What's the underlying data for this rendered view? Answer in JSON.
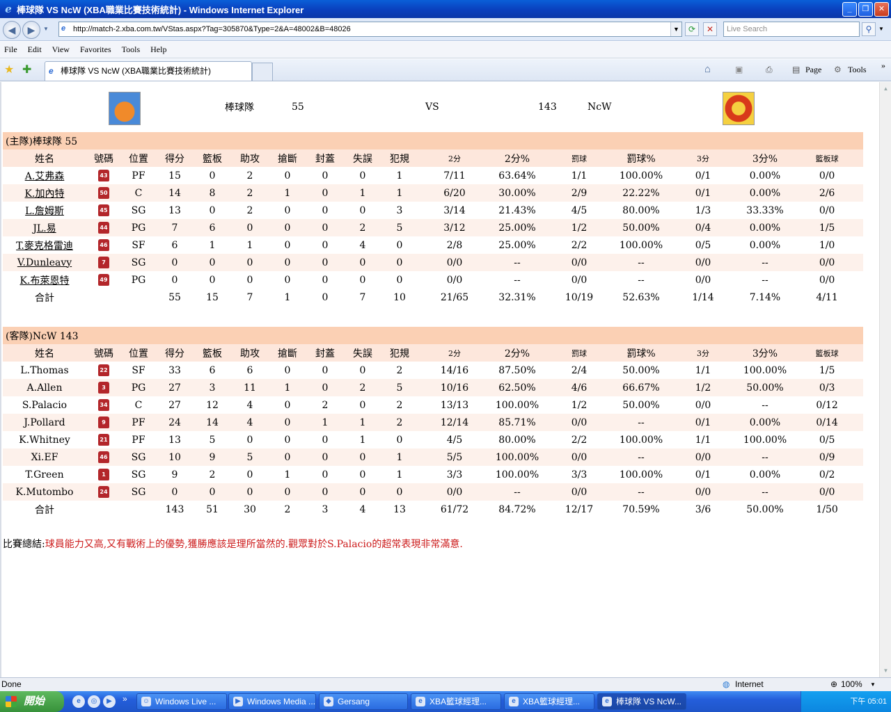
{
  "window": {
    "title": "棒球隊 VS NcW (XBA職業比賽技術統計) - Windows Internet Explorer"
  },
  "address": {
    "url": "http://match-2.xba.com.tw/VStas.aspx?Tag=305870&Type=2&A=48002&B=48026",
    "search_placeholder": "Live Search"
  },
  "menu": [
    "File",
    "Edit",
    "View",
    "Favorites",
    "Tools",
    "Help"
  ],
  "tab": {
    "title": "棒球隊 VS NcW (XBA職業比賽技術統計)"
  },
  "toolbar": {
    "page": "Page",
    "tools": "Tools"
  },
  "match": {
    "home_name": "棒球隊",
    "home_score": "55",
    "vs": "VS",
    "away_score": "143",
    "away_name": "NcW"
  },
  "columns": [
    "姓名",
    "號碼",
    "位置",
    "得分",
    "籃板",
    "助攻",
    "搶斷",
    "封蓋",
    "失誤",
    "犯規",
    "2分",
    "2分%",
    "罰球",
    "罰球%",
    "3分",
    "3分%",
    "籃板球"
  ],
  "home": {
    "label": "(主隊)棒球隊 55",
    "players": [
      {
        "name": "A.艾弗森",
        "num": "43",
        "pos": "PF",
        "pts": "15",
        "reb": "0",
        "ast": "2",
        "stl": "0",
        "blk": "0",
        "to": "0",
        "pf": "1",
        "fg2": "7/11",
        "fg2p": "63.64%",
        "ft": "1/1",
        "ftp": "100.00%",
        "fg3": "0/1",
        "fg3p": "0.00%",
        "rb": "0/0"
      },
      {
        "name": "K.加內特",
        "num": "50",
        "pos": "C",
        "pts": "14",
        "reb": "8",
        "ast": "2",
        "stl": "1",
        "blk": "0",
        "to": "1",
        "pf": "1",
        "fg2": "6/20",
        "fg2p": "30.00%",
        "ft": "2/9",
        "ftp": "22.22%",
        "fg3": "0/1",
        "fg3p": "0.00%",
        "rb": "2/6"
      },
      {
        "name": "L.詹姆斯",
        "num": "45",
        "pos": "SG",
        "pts": "13",
        "reb": "0",
        "ast": "2",
        "stl": "0",
        "blk": "0",
        "to": "0",
        "pf": "3",
        "fg2": "3/14",
        "fg2p": "21.43%",
        "ft": "4/5",
        "ftp": "80.00%",
        "fg3": "1/3",
        "fg3p": "33.33%",
        "rb": "0/0"
      },
      {
        "name": "JL.易",
        "num": "44",
        "pos": "PG",
        "pts": "7",
        "reb": "6",
        "ast": "0",
        "stl": "0",
        "blk": "0",
        "to": "2",
        "pf": "5",
        "fg2": "3/12",
        "fg2p": "25.00%",
        "ft": "1/2",
        "ftp": "50.00%",
        "fg3": "0/4",
        "fg3p": "0.00%",
        "rb": "1/5"
      },
      {
        "name": "T.麥克格雷迪",
        "num": "46",
        "pos": "SF",
        "pts": "6",
        "reb": "1",
        "ast": "1",
        "stl": "0",
        "blk": "0",
        "to": "4",
        "pf": "0",
        "fg2": "2/8",
        "fg2p": "25.00%",
        "ft": "2/2",
        "ftp": "100.00%",
        "fg3": "0/5",
        "fg3p": "0.00%",
        "rb": "1/0"
      },
      {
        "name": "V.Dunleavy",
        "num": "7",
        "pos": "SG",
        "pts": "0",
        "reb": "0",
        "ast": "0",
        "stl": "0",
        "blk": "0",
        "to": "0",
        "pf": "0",
        "fg2": "0/0",
        "fg2p": "--",
        "ft": "0/0",
        "ftp": "--",
        "fg3": "0/0",
        "fg3p": "--",
        "rb": "0/0"
      },
      {
        "name": "K.布萊恩特",
        "num": "49",
        "pos": "PG",
        "pts": "0",
        "reb": "0",
        "ast": "0",
        "stl": "0",
        "blk": "0",
        "to": "0",
        "pf": "0",
        "fg2": "0/0",
        "fg2p": "--",
        "ft": "0/0",
        "ftp": "--",
        "fg3": "0/0",
        "fg3p": "--",
        "rb": "0/0"
      }
    ],
    "total": {
      "label": "合計",
      "pts": "55",
      "reb": "15",
      "ast": "7",
      "stl": "1",
      "blk": "0",
      "to": "7",
      "pf": "10",
      "fg2": "21/65",
      "fg2p": "32.31%",
      "ft": "10/19",
      "ftp": "52.63%",
      "fg3": "1/14",
      "fg3p": "7.14%",
      "rb": "4/11"
    }
  },
  "away": {
    "label": "(客隊)NcW 143",
    "players": [
      {
        "name": "L.Thomas",
        "num": "22",
        "pos": "SF",
        "pts": "33",
        "reb": "6",
        "ast": "6",
        "stl": "0",
        "blk": "0",
        "to": "0",
        "pf": "2",
        "fg2": "14/16",
        "fg2p": "87.50%",
        "ft": "2/4",
        "ftp": "50.00%",
        "fg3": "1/1",
        "fg3p": "100.00%",
        "rb": "1/5"
      },
      {
        "name": "A.Allen",
        "num": "3",
        "pos": "PG",
        "pts": "27",
        "reb": "3",
        "ast": "11",
        "stl": "1",
        "blk": "0",
        "to": "2",
        "pf": "5",
        "fg2": "10/16",
        "fg2p": "62.50%",
        "ft": "4/6",
        "ftp": "66.67%",
        "fg3": "1/2",
        "fg3p": "50.00%",
        "rb": "0/3"
      },
      {
        "name": "S.Palacio",
        "num": "34",
        "pos": "C",
        "pts": "27",
        "reb": "12",
        "ast": "4",
        "stl": "0",
        "blk": "2",
        "to": "0",
        "pf": "2",
        "fg2": "13/13",
        "fg2p": "100.00%",
        "ft": "1/2",
        "ftp": "50.00%",
        "fg3": "0/0",
        "fg3p": "--",
        "rb": "0/12"
      },
      {
        "name": "J.Pollard",
        "num": "9",
        "pos": "PF",
        "pts": "24",
        "reb": "14",
        "ast": "4",
        "stl": "0",
        "blk": "1",
        "to": "1",
        "pf": "2",
        "fg2": "12/14",
        "fg2p": "85.71%",
        "ft": "0/0",
        "ftp": "--",
        "fg3": "0/1",
        "fg3p": "0.00%",
        "rb": "0/14"
      },
      {
        "name": "K.Whitney",
        "num": "21",
        "pos": "PF",
        "pts": "13",
        "reb": "5",
        "ast": "0",
        "stl": "0",
        "blk": "0",
        "to": "1",
        "pf": "0",
        "fg2": "4/5",
        "fg2p": "80.00%",
        "ft": "2/2",
        "ftp": "100.00%",
        "fg3": "1/1",
        "fg3p": "100.00%",
        "rb": "0/5"
      },
      {
        "name": "Xi.EF",
        "num": "46",
        "pos": "SG",
        "pts": "10",
        "reb": "9",
        "ast": "5",
        "stl": "0",
        "blk": "0",
        "to": "0",
        "pf": "1",
        "fg2": "5/5",
        "fg2p": "100.00%",
        "ft": "0/0",
        "ftp": "--",
        "fg3": "0/0",
        "fg3p": "--",
        "rb": "0/9"
      },
      {
        "name": "T.Green",
        "num": "1",
        "pos": "SG",
        "pts": "9",
        "reb": "2",
        "ast": "0",
        "stl": "1",
        "blk": "0",
        "to": "0",
        "pf": "1",
        "fg2": "3/3",
        "fg2p": "100.00%",
        "ft": "3/3",
        "ftp": "100.00%",
        "fg3": "0/1",
        "fg3p": "0.00%",
        "rb": "0/2"
      },
      {
        "name": "K.Mutombo",
        "num": "24",
        "pos": "SG",
        "pts": "0",
        "reb": "0",
        "ast": "0",
        "stl": "0",
        "blk": "0",
        "to": "0",
        "pf": "0",
        "fg2": "0/0",
        "fg2p": "--",
        "ft": "0/0",
        "ftp": "--",
        "fg3": "0/0",
        "fg3p": "--",
        "rb": "0/0"
      }
    ],
    "total": {
      "label": "合計",
      "pts": "143",
      "reb": "51",
      "ast": "30",
      "stl": "2",
      "blk": "3",
      "to": "4",
      "pf": "13",
      "fg2": "61/72",
      "fg2p": "84.72%",
      "ft": "12/17",
      "ftp": "70.59%",
      "fg3": "3/6",
      "fg3p": "50.00%",
      "rb": "1/50"
    }
  },
  "summary": {
    "label": "比賽總結:",
    "text": "球員能力又高,又有戰術上的優勢,獲勝應該是理所當然的.觀眾對於S.Palacio的超常表現非常滿意."
  },
  "status": {
    "left": "Done",
    "zone": "Internet",
    "zoom": "100%"
  },
  "taskbar": {
    "start": "開始",
    "items": [
      "Windows Live ...",
      "Windows Media ...",
      "Gersang",
      "XBA籃球經理...",
      "XBA籃球經理...",
      "棒球隊 VS NcW..."
    ],
    "clock": "下午 05:01"
  }
}
